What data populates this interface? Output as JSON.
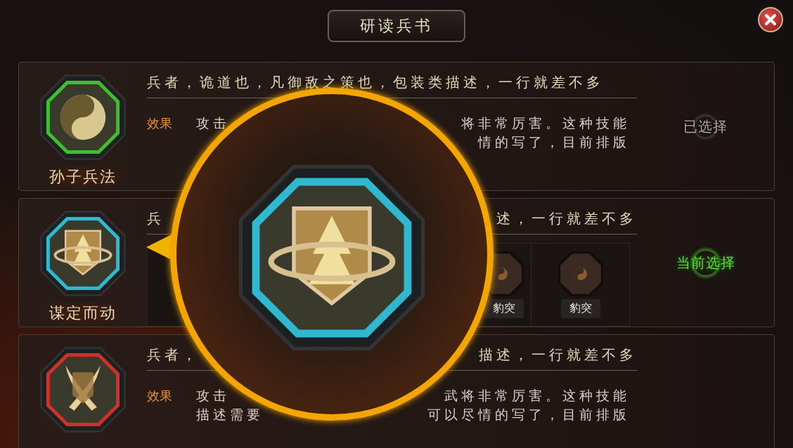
{
  "window": {
    "title": "研读兵书"
  },
  "books": [
    {
      "name": "孙子兵法",
      "kind": "yinyang",
      "color": "#3fbf2f",
      "description": {
        "left": "兵者，诡道也，凡御敌之策也，包装类描述，一行就差不多"
      },
      "effect_label": "效果",
      "effect_lines": [
        {
          "left": "攻击",
          "right": "将非常厉害。这种技能"
        },
        {
          "right": "情的写了，目前排版"
        }
      ],
      "status": {
        "kind": "chosen",
        "label": "已选择"
      }
    },
    {
      "name": "谋定而动",
      "kind": "shield",
      "color": "#2fb8d0",
      "description": {
        "left": "兵",
        "right": "述，一行就差不多"
      },
      "slots": [
        "豹突",
        "豹突"
      ],
      "status": {
        "kind": "current",
        "label": "当前选择"
      }
    },
    {
      "kind": "blades",
      "color": "#d0302a",
      "description": {
        "left": "兵者，",
        "right": "描述，一行就差不多"
      },
      "effect_label": "效果",
      "effect_lines": [
        {
          "left": "攻击",
          "right": "武将非常厉害。这种技能"
        },
        {
          "left": "描述需要",
          "right": "可以尽情的写了，目前排版"
        }
      ]
    }
  ],
  "lens": {
    "kind": "shield",
    "color": "#2fb8d0"
  }
}
